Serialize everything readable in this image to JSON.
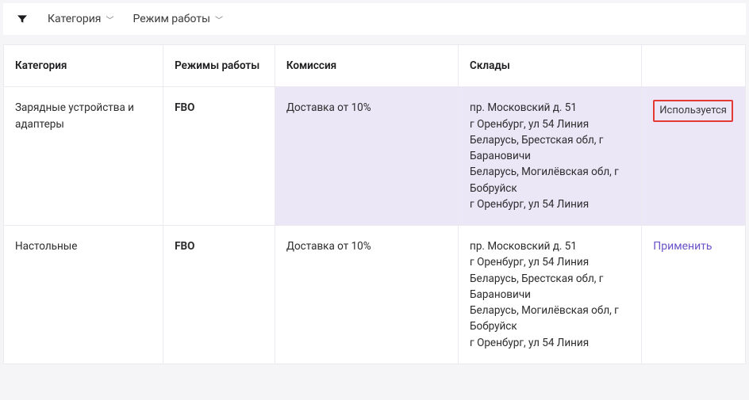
{
  "filters": {
    "category_label": "Категория",
    "mode_label": "Режим работы"
  },
  "table": {
    "headers": {
      "category": "Категория",
      "modes": "Режимы работы",
      "commission": "Комиссия",
      "warehouses": "Склады"
    },
    "rows": [
      {
        "category": "Зарядные устройства и адаптеры",
        "mode": "FBO",
        "commission": "Доставка от 10%",
        "warehouses": [
          "пр. Московский д. 51",
          "г Оренбург, ул 54 Линия",
          "Беларусь, Брестская обл, г Барановичи",
          "Беларусь, Могилёвская обл, г Бобруйск",
          "г Оренбург, ул 54 Линия"
        ],
        "status_label": "Используется",
        "status_kind": "used"
      },
      {
        "category": "Настольные",
        "mode": "FBO",
        "commission": "Доставка от 10%",
        "warehouses": [
          "пр. Московский д. 51",
          "г Оренбург, ул 54 Линия",
          "Беларусь, Брестская обл, г Барановичи",
          "Беларусь, Могилёвская обл, г Бобруйск",
          "г Оренбург, ул 54 Линия"
        ],
        "status_label": "Применить",
        "status_kind": "apply"
      }
    ]
  }
}
